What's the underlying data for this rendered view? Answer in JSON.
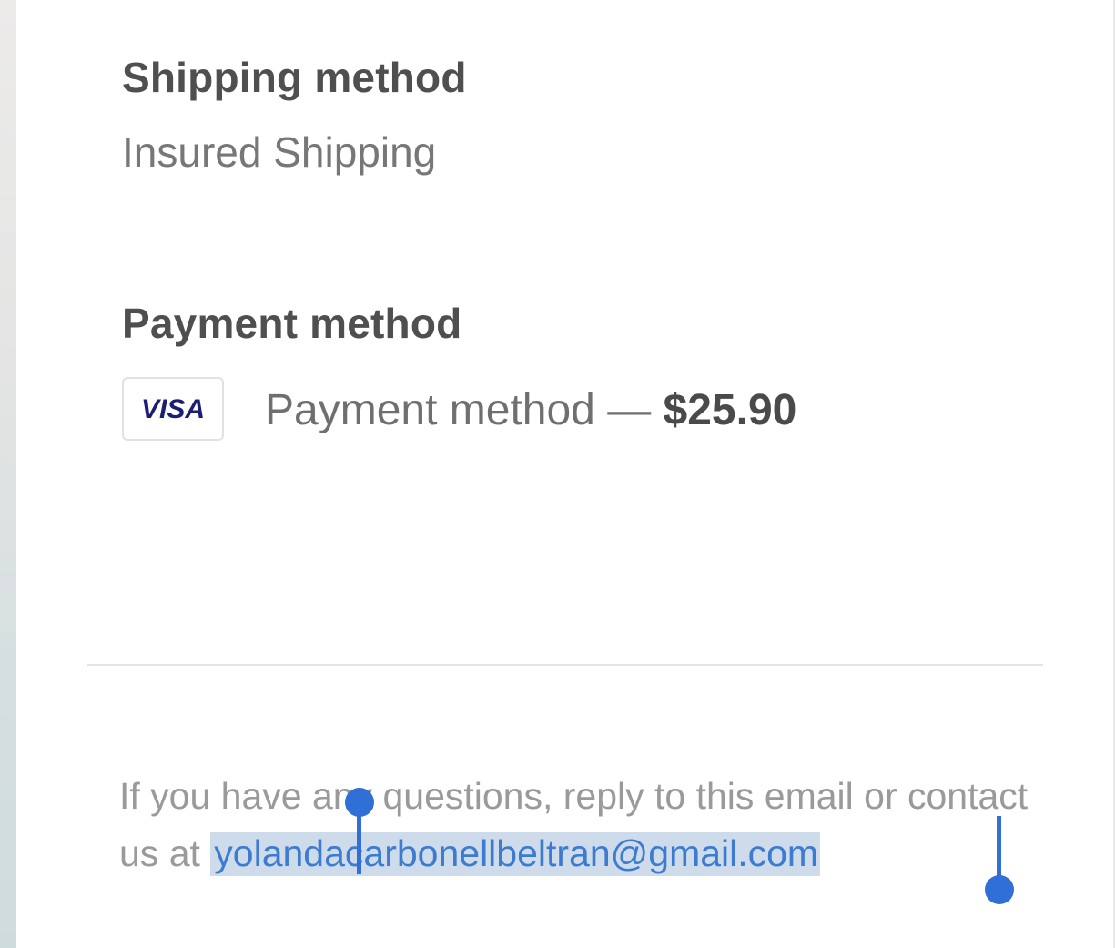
{
  "shipping": {
    "heading": "Shipping method",
    "value": "Insured Shipping"
  },
  "payment": {
    "heading": "Payment method",
    "card_brand": "VISA",
    "card_icon": "visa-card-icon",
    "line_label": "Payment method — ",
    "amount": "$25.90"
  },
  "footer": {
    "text_before": "If you have any questions, reply to this email or contact us at ",
    "email": "yolandacarbonellbeltran@gmail.com"
  },
  "colors": {
    "heading": "#4f4f4f",
    "muted_text": "#9a9a9a",
    "link": "#3c7bd0",
    "selection_highlight": "#cddbea",
    "selection_handle": "#2f6fd6",
    "visa_blue": "#1a1f71"
  }
}
